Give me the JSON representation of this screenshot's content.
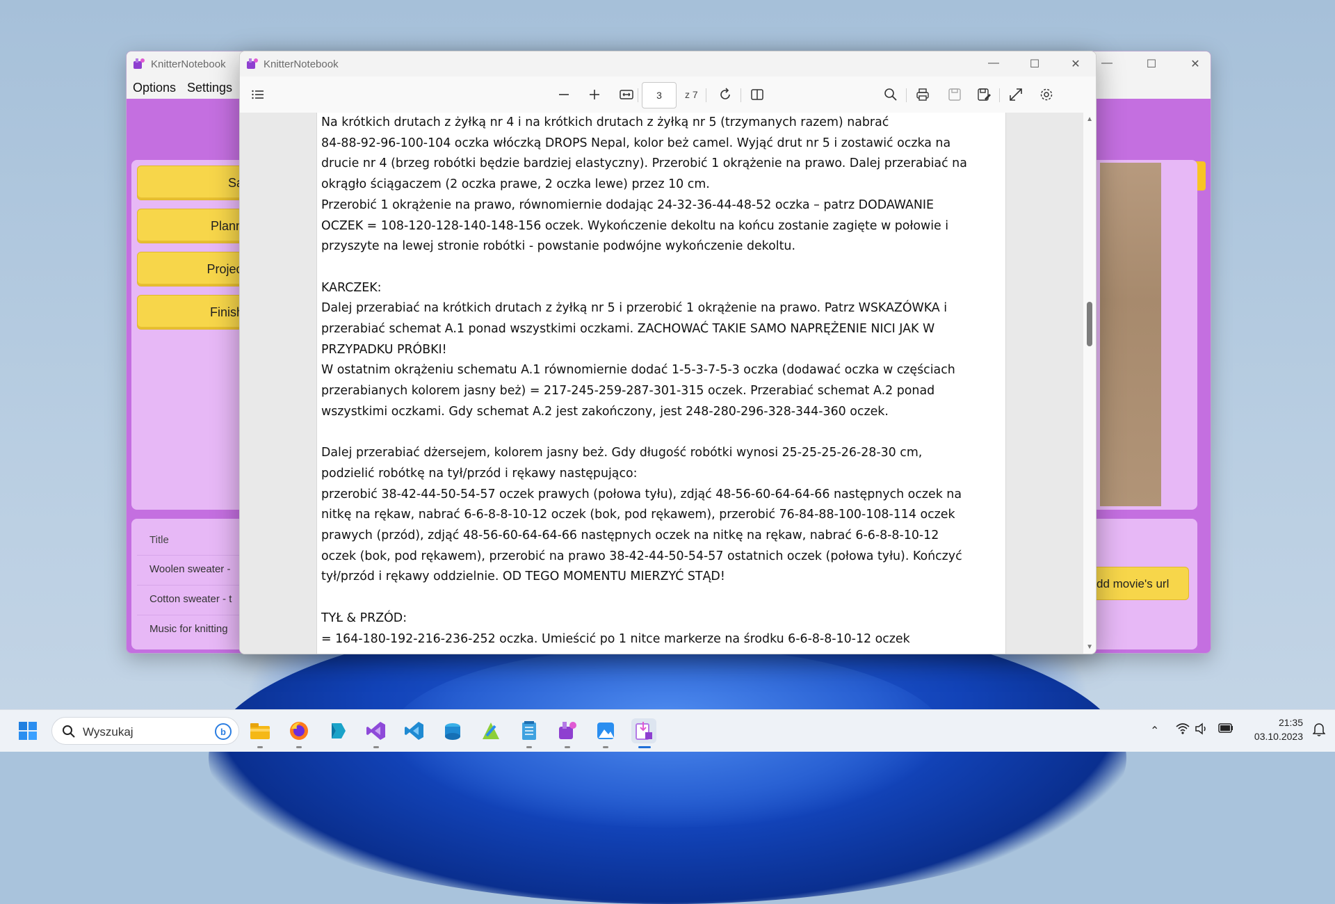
{
  "back_window": {
    "title": "KnitterNotebook",
    "menu": [
      "Options",
      "Settings"
    ],
    "nav_buttons": [
      "Samples",
      "Planned projec",
      "Projects in progr",
      "Finished projec"
    ],
    "list": {
      "header": "Title",
      "rows": [
        "Woolen sweater -",
        "Cotton sweater - t",
        "Music for knitting"
      ]
    },
    "url_button": "dd movie's url"
  },
  "pdf_window": {
    "title": "KnitterNotebook",
    "page_current": "3",
    "page_total_label": "z 7",
    "lines": [
      "Na krótkich drutach z żyłką nr 4 i na krótkich drutach z żyłką nr 5 (trzymanych razem) nabrać",
      "84-88-92-96-100-104 oczka włóczką DROPS Nepal, kolor beż camel. Wyjąć drut nr 5 i zostawić oczka na",
      "drucie nr 4 (brzeg robótki będzie bardziej elastyczny). Przerobić 1 okrążenie na prawo. Dalej przerabiać na",
      "okrągło ściągaczem (2 oczka prawe, 2 oczka lewe) przez 10 cm.",
      "Przerobić 1 okrążenie na prawo, równomiernie dodając 24-32-36-44-48-52 oczka – patrz DODAWANIE",
      "OCZEK = 108-120-128-140-148-156 oczek. Wykończenie dekoltu na końcu zostanie zagięte w połowie i",
      "przyszyte na lewej stronie robótki - powstanie podwójne wykończenie dekoltu.",
      "",
      "KARCZEK:",
      "Dalej przerabiać na krótkich drutach z żyłką nr 5 i przerobić 1 okrążenie na prawo. Patrz WSKAZÓWKA i",
      "przerabiać schemat A.1 ponad wszystkimi oczkami. ZACHOWAĆ TAKIE SAMO NAPRĘŻENIE NICI JAK W",
      "PRZYPADKU PRÓBKI!",
      "W ostatnim okrążeniu schematu A.1 równomiernie dodać 1-5-3-7-5-3 oczka (dodawać oczka w częściach",
      "przerabianych kolorem jasny beż) = 217-245-259-287-301-315 oczek. Przerabiać schemat A.2 ponad",
      "wszystkimi oczkami. Gdy schemat A.2 jest zakończony, jest 248-280-296-328-344-360 oczek.",
      "",
      "Dalej przerabiać dżersejem, kolorem jasny beż. Gdy długość robótki wynosi 25-25-25-26-28-30 cm,",
      "podzielić robótkę na tył/przód i rękawy następująco:",
      "przerobić 38-42-44-50-54-57 oczek prawych (połowa tyłu), zdjąć 48-56-60-64-64-66 następnych oczek na",
      "nitkę na rękaw, nabrać 6-6-8-8-10-12 oczek (bok, pod rękawem), przerobić 76-84-88-100-108-114 oczek",
      "prawych (przód), zdjąć 48-56-60-64-64-66 następnych oczek na nitkę na rękaw, nabrać 6-6-8-8-10-12",
      "oczek (bok, pod rękawem), przerobić na prawo 38-42-44-50-54-57 ostatnich oczek (połowa tyłu). Kończyć",
      "tył/przód i rękawy oddzielnie. OD TEGO MOMENTU MIERZYĆ STĄD!",
      "",
      "TYŁ & PRZÓD:",
      "= 164-180-192-216-236-252 oczka. Umieścić po 1 nitce markerze na środku 6-6-8-8-10-12 oczek"
    ]
  },
  "taskbar": {
    "search_placeholder": "Wyszukaj",
    "time": "21:35",
    "date": "03.10.2023"
  },
  "colors": {
    "accent_purple": "#c46fe0",
    "panel_purple": "#e7b8f6",
    "button_yellow": "#f7d64a"
  }
}
